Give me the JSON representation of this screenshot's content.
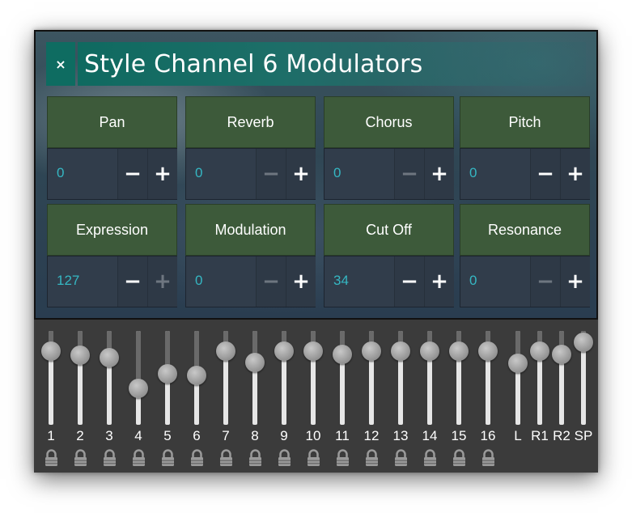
{
  "window": {
    "close_icon": "close-icon",
    "close_glyph": "×",
    "title": "Style Channel 6 Modulators"
  },
  "colors": {
    "title_bar": "#0e6c61",
    "label_green": "#3d5a3a",
    "value_cyan": "#35b7c3",
    "value_row_bg": "#313d4b",
    "mixer_bg": "#3b3b3b"
  },
  "modulators": [
    {
      "label": "Pan",
      "value": "0",
      "minus": "−",
      "plus": "+",
      "minus_enabled": true,
      "plus_enabled": true
    },
    {
      "label": "Reverb",
      "value": "0",
      "minus": "−",
      "plus": "+",
      "minus_enabled": false,
      "plus_enabled": true
    },
    {
      "label": "Chorus",
      "value": "0",
      "minus": "−",
      "plus": "+",
      "minus_enabled": false,
      "plus_enabled": true
    },
    {
      "label": "Pitch",
      "value": "0",
      "minus": "−",
      "plus": "+",
      "minus_enabled": true,
      "plus_enabled": true
    },
    {
      "label": "Expression",
      "value": "127",
      "minus": "−",
      "plus": "+",
      "minus_enabled": true,
      "plus_enabled": false
    },
    {
      "label": "Modulation",
      "value": "0",
      "minus": "−",
      "plus": "+",
      "minus_enabled": false,
      "plus_enabled": true
    },
    {
      "label": "Cut Off",
      "value": "34",
      "minus": "−",
      "plus": "+",
      "minus_enabled": true,
      "plus_enabled": true
    },
    {
      "label": "Resonance",
      "value": "0",
      "minus": "−",
      "plus": "+",
      "minus_enabled": false,
      "plus_enabled": true
    }
  ],
  "mixer": {
    "channels": [
      {
        "label": "1",
        "level": 0.86,
        "locked": true
      },
      {
        "label": "2",
        "level": 0.8,
        "locked": true
      },
      {
        "label": "3",
        "level": 0.77,
        "locked": true
      },
      {
        "label": "4",
        "level": 0.36,
        "locked": true
      },
      {
        "label": "5",
        "level": 0.55,
        "locked": true
      },
      {
        "label": "6",
        "level": 0.53,
        "locked": true
      },
      {
        "label": "7",
        "level": 0.86,
        "locked": true
      },
      {
        "label": "8",
        "level": 0.71,
        "locked": true
      },
      {
        "label": "9",
        "level": 0.86,
        "locked": true
      },
      {
        "label": "10",
        "level": 0.86,
        "locked": true
      },
      {
        "label": "11",
        "level": 0.82,
        "locked": true
      },
      {
        "label": "12",
        "level": 0.86,
        "locked": true
      },
      {
        "label": "13",
        "level": 0.86,
        "locked": true
      },
      {
        "label": "14",
        "level": 0.86,
        "locked": true
      },
      {
        "label": "15",
        "level": 0.86,
        "locked": true
      },
      {
        "label": "16",
        "level": 0.86,
        "locked": true
      },
      {
        "label": "L",
        "level": 0.7,
        "locked": false
      },
      {
        "label": "R1",
        "level": 0.86,
        "locked": false
      },
      {
        "label": "R2",
        "level": 0.82,
        "locked": false
      },
      {
        "label": "SP",
        "level": 0.98,
        "locked": false
      }
    ]
  }
}
